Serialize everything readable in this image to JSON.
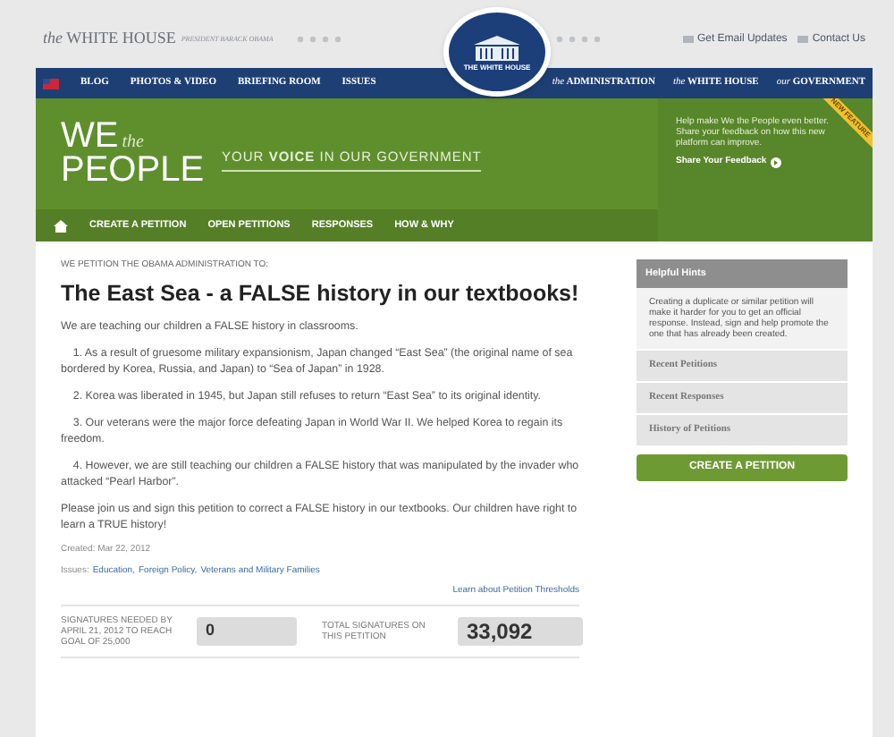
{
  "header": {
    "site_title_prefix": "the",
    "site_title": "WHITE HOUSE",
    "site_subtitle": "PRESIDENT BARACK OBAMA",
    "seal_text": "THE WHITE HOUSE",
    "links": [
      "Get Email Updates",
      "Contact Us"
    ]
  },
  "main_nav": {
    "left": [
      "BLOG",
      "PHOTOS & VIDEO",
      "BRIEFING ROOM",
      "ISSUES"
    ],
    "right": [
      {
        "prefix": "the",
        "label": "ADMINISTRATION"
      },
      {
        "prefix": "the",
        "label": "WHITE HOUSE"
      },
      {
        "prefix": "our",
        "label": "GOVERNMENT"
      }
    ]
  },
  "banner": {
    "logo_we": "WE",
    "logo_the": "the",
    "logo_people": "PEOPLE",
    "tagline": "YOUR **VOICE** IN OUR GOVERNMENT",
    "feedback_text": "Help make We the People even better. Share your feedback on how this new platform can improve.",
    "feedback_link": "Share Your Feedback",
    "ribbon": "NEW FEATURE"
  },
  "petition_nav": [
    "CREATE A PETITION",
    "OPEN PETITIONS",
    "RESPONSES",
    "HOW & WHY"
  ],
  "petition": {
    "kicker": "WE PETITION THE OBAMA ADMINISTRATION TO:",
    "title": "The East Sea - a FALSE history in our textbooks!",
    "paragraphs": [
      "We are teaching our children a FALSE history in classrooms.",
      "    1. As a result of gruesome military expansionism, Japan changed “East Sea” (the original name of sea bordered by Korea, Russia, and Japan) to “Sea of Japan” in 1928.",
      "    2. Korea was liberated in 1945, but Japan still refuses to return “East Sea” to its original identity.",
      "    3. Our veterans were the major force defeating Japan in World War II. We helped Korea to regain its freedom.",
      "    4. However, we are still teaching our children a FALSE history that was manipulated by the invader who attacked “Pearl Harbor”.",
      "Please join us and sign this petition to correct a FALSE history in our textbooks. Our children have right to learn a TRUE history!"
    ],
    "created_label": "Created:",
    "created": "Mar 22, 2012",
    "issues_label": "Issues:",
    "issues": [
      "Education,",
      "Foreign Policy,",
      "Veterans and Military Families"
    ],
    "threshold_link": "Learn about Petition Thresholds",
    "counters": [
      {
        "label": "SIGNATURES NEEDED BY APRIL 21, 2012 TO REACH GOAL OF 25,000",
        "value": "0"
      },
      {
        "label": "TOTAL SIGNATURES ON THIS PETITION",
        "value": "33,092"
      }
    ]
  },
  "sidebar": {
    "hints_title": "Helpful Hints",
    "hints_text": "Creating a duplicate or similar petition will make it harder for you to get an official response. Instead, sign and help promote the one that has already been created.",
    "links": [
      "Recent Petitions",
      "Recent Responses",
      "History of Petitions"
    ],
    "button": "CREATE A PETITION"
  }
}
